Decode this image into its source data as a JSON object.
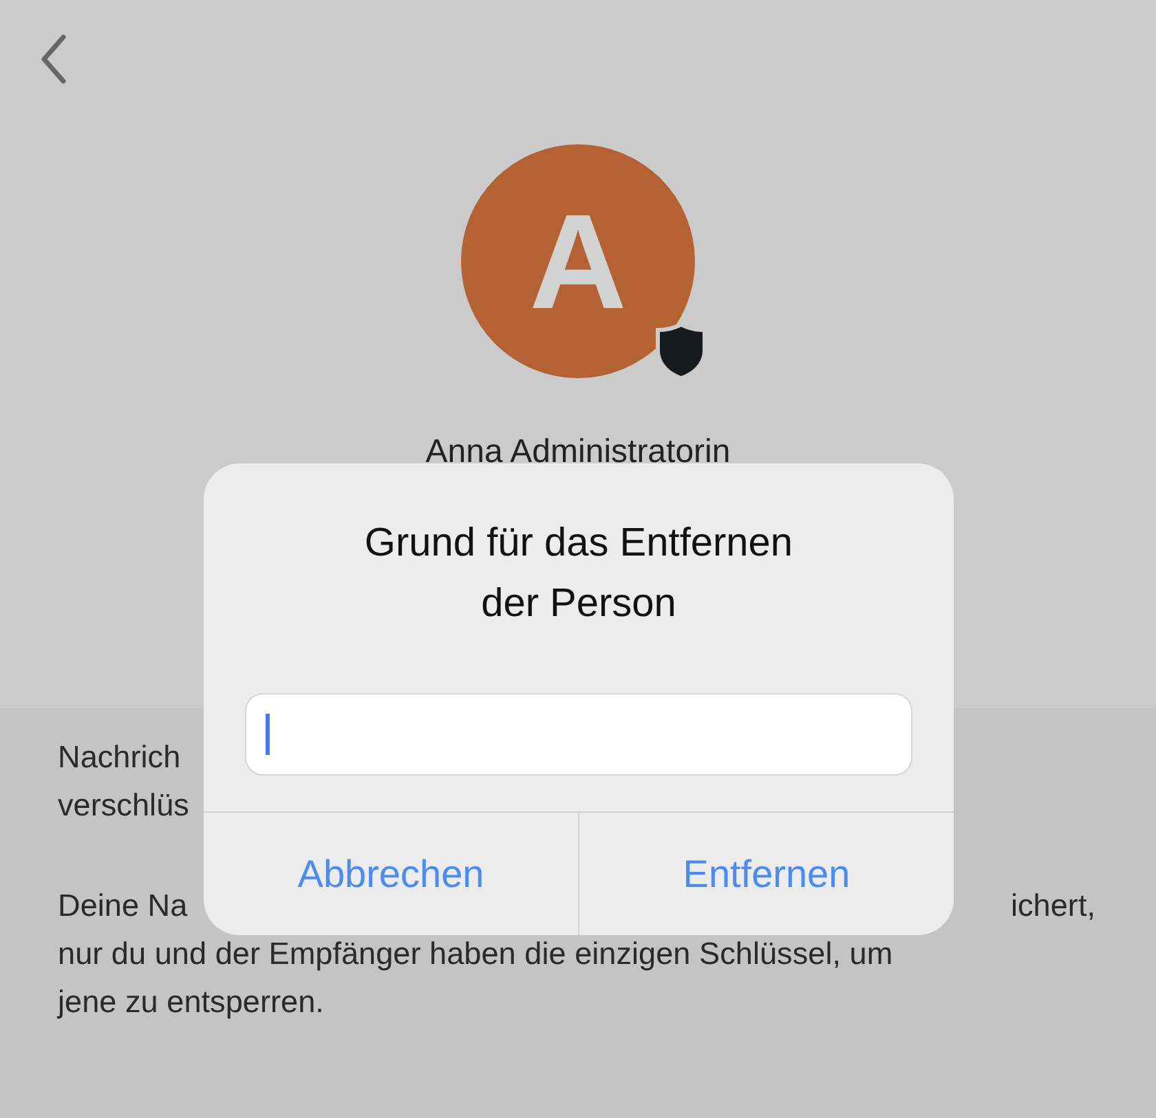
{
  "profile": {
    "initial": "A",
    "admin": true,
    "name": "Anna Administratorin"
  },
  "info_paragraphs": [
    {
      "lines": [
        {
          "left": "Nachrich"
        },
        {
          "left": "verschlüs"
        }
      ]
    },
    {
      "lines": [
        {
          "left": "Deine Na",
          "right": "ichert,"
        },
        {
          "left": "nur du und der Empfänger haben die einzigen Schlüssel, um"
        },
        {
          "left": "jene zu entsperren."
        }
      ]
    }
  ],
  "dialog": {
    "title": "Grund für das Entfernen der Person",
    "field": {
      "focused": true
    },
    "buttons": [
      {
        "label": "Abbrechen"
      },
      {
        "label": "Entfernen"
      }
    ]
  }
}
